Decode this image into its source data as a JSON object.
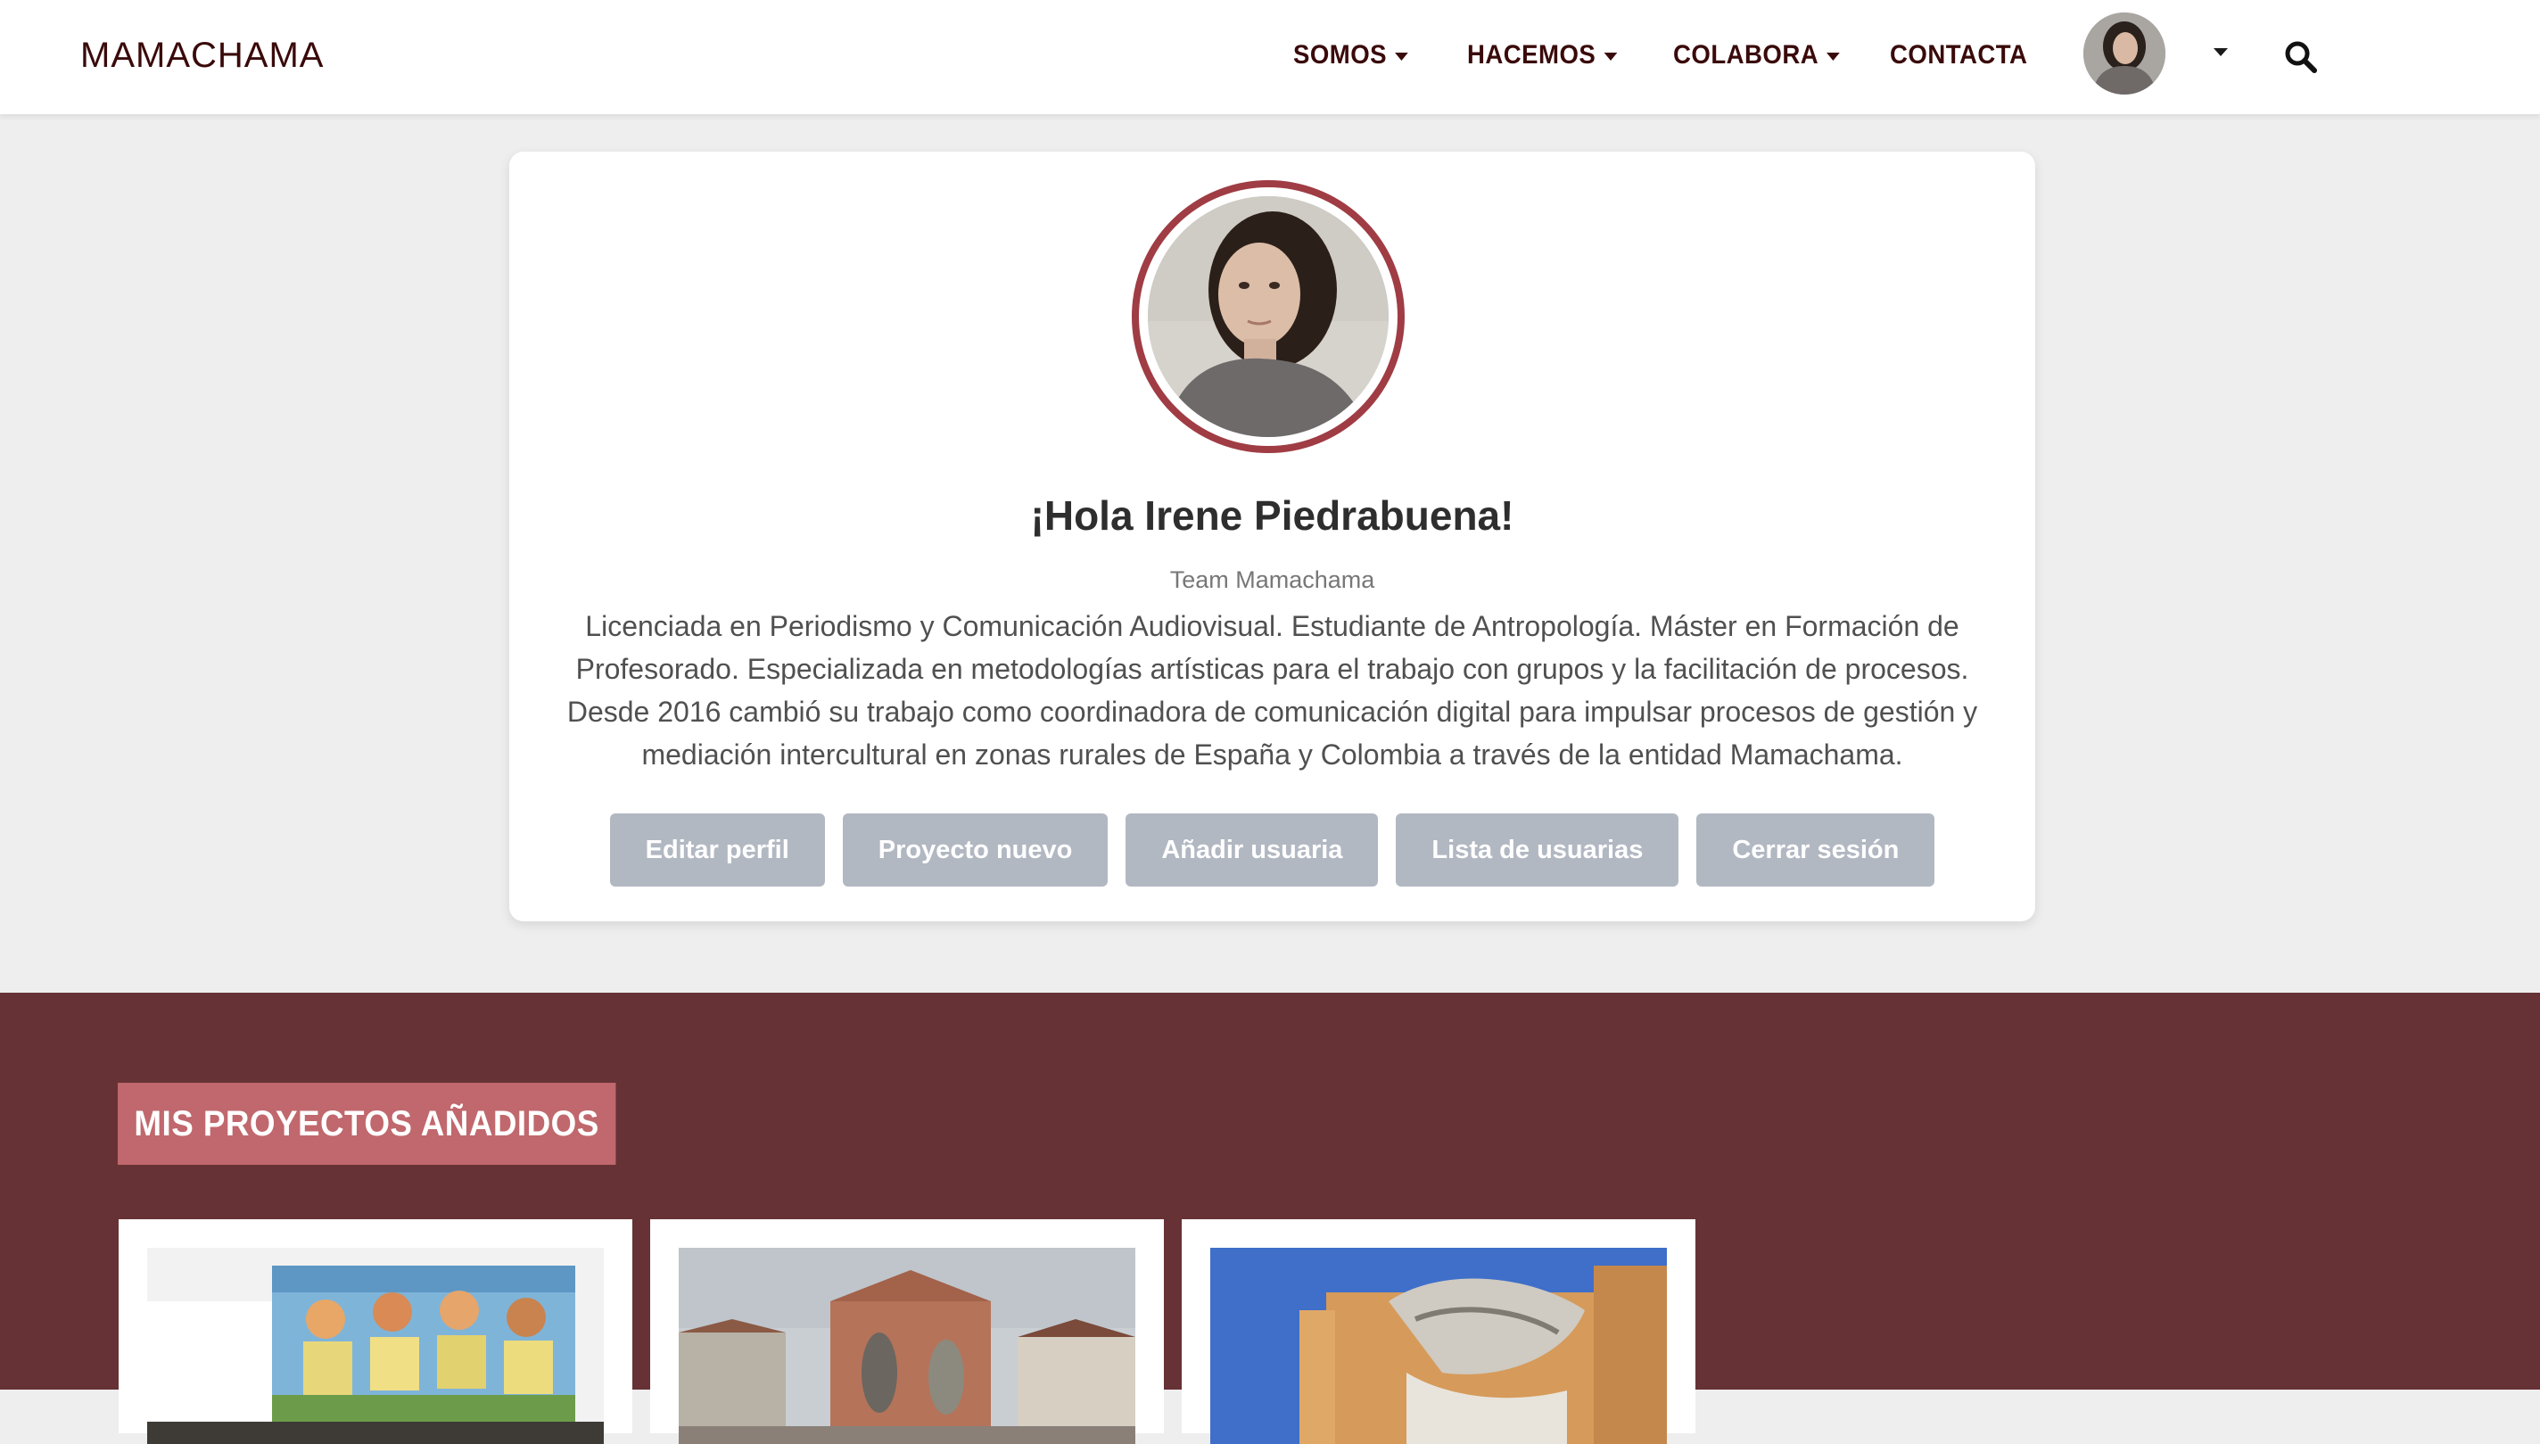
{
  "brand": "MAMACHAMA",
  "nav": {
    "items": [
      {
        "label": "SOMOS",
        "has_caret": true
      },
      {
        "label": "HACEMOS",
        "has_caret": true
      },
      {
        "label": "COLABORA",
        "has_caret": true
      },
      {
        "label": "CONTACTA",
        "has_caret": false
      }
    ],
    "avatar_icon": "user-avatar",
    "search_icon": "search-icon"
  },
  "profile": {
    "greeting": "¡Hola Irene Piedrabuena!",
    "role": "Team Mamachama",
    "bio": "Licenciada en Periodismo y Comunicación Audiovisual. Estudiante de Antropología. Máster en Formación de Profesorado. Especializada en metodologías artísticas para el trabajo con grupos y la facilitación de procesos. Desde 2016 cambió su trabajo como coordinadora de comunicación digital para impulsar procesos de gestión y mediación intercultural en zonas rurales de España y Colombia a través de la entidad Mamachama.",
    "buttons": {
      "edit": "Editar perfil",
      "new_project": "Proyecto nuevo",
      "add_user": "Añadir usuaria",
      "user_list": "Lista de usuarias",
      "logout": "Cerrar sesión"
    }
  },
  "projects": {
    "title": "MIS PROYECTOS AÑADIDOS",
    "items": [
      {
        "image": "mural-four-women"
      },
      {
        "image": "mural-village-street"
      },
      {
        "image": "mural-building-blue-sky"
      }
    ]
  },
  "colors": {
    "brand_text": "#3a0a0a",
    "avatar_ring": "#a03c44",
    "button_bg": "#b2b8c2",
    "section_bg": "#663235",
    "section_title_bg": "#c0686d",
    "page_bg": "#eeeeee"
  }
}
